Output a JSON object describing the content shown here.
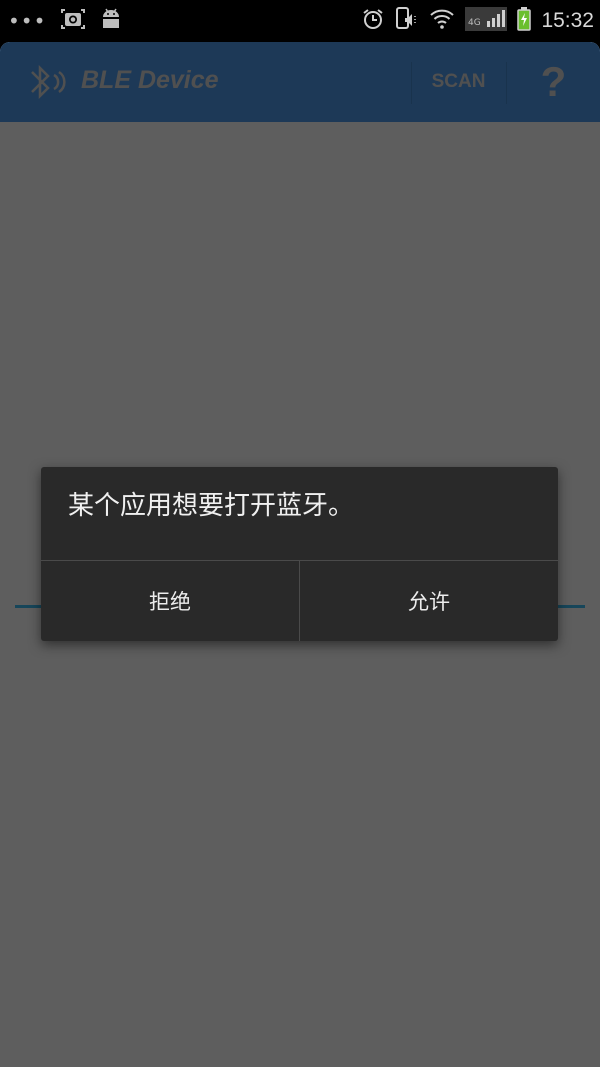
{
  "status_bar": {
    "time": "15:32",
    "left_icons": [
      "more-dots-icon",
      "screenshot-icon",
      "android-icon"
    ],
    "right_icons": [
      "alarm-icon",
      "phone-silent-icon",
      "wifi-icon",
      "signal-4g-icon",
      "battery-charging-icon"
    ],
    "network_label": "4G"
  },
  "action_bar": {
    "title": "BLE Device",
    "logo_icon": "bluetooth-icon",
    "scan_label": "SCAN",
    "help_label": "?",
    "color": "#4a90d9"
  },
  "dialog": {
    "message": "某个应用想要打开蓝牙。",
    "deny_label": "拒绝",
    "allow_label": "允许"
  }
}
